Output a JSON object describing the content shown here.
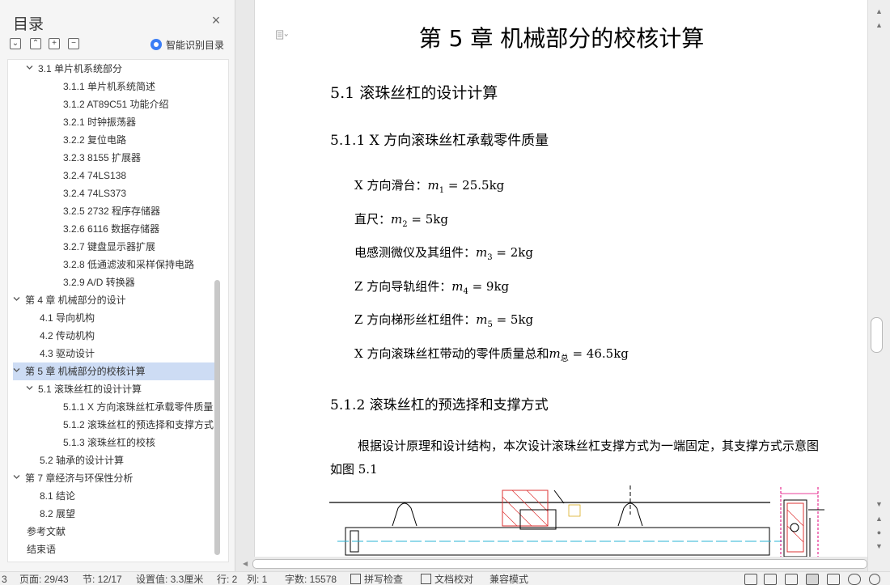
{
  "nav": {
    "title": "目录",
    "close": "×",
    "tools": [
      "⌄",
      "⌃",
      "+",
      "−"
    ],
    "smart_label": "智能识别目录",
    "items": [
      {
        "label": "3.1 单片机系统部分",
        "level": 1,
        "chev": true
      },
      {
        "label": "3.1.1 单片机系统简述",
        "level": 2
      },
      {
        "label": "3.1.2 AT89C51 功能介绍",
        "level": 2
      },
      {
        "label": "3.2.1 时钟振荡器",
        "level": 2
      },
      {
        "label": "3.2.2 复位电路",
        "level": 2
      },
      {
        "label": "3.2.3 8155 扩展器",
        "level": 2
      },
      {
        "label": "3.2.4 74LS138",
        "level": 2
      },
      {
        "label": "3.2.4 74LS373",
        "level": 2
      },
      {
        "label": "3.2.5 2732 程序存储器",
        "level": 2
      },
      {
        "label": "3.2.6 6116 数据存储器",
        "level": 2
      },
      {
        "label": "3.2.7  键盘显示器扩展",
        "level": 2
      },
      {
        "label": "3.2.8  低通滤波和采样保持电路",
        "level": 2
      },
      {
        "label": "3.2.9 A/D 转换器",
        "level": 2
      },
      {
        "label": "第 4 章  机械部分的设计",
        "level": 0,
        "chev": true
      },
      {
        "label": "4.1 导向机构",
        "level": 1
      },
      {
        "label": "4.2 传动机构",
        "level": 1
      },
      {
        "label": "4.3  驱动设计",
        "level": 1
      },
      {
        "label": "第 5 章  机械部分的校核计算",
        "level": 0,
        "chev": true,
        "selected": true
      },
      {
        "label": "5.1 滚珠丝杠的设计计算",
        "level": 1,
        "chev": true
      },
      {
        "label": "5.1.1 X 方向滚珠丝杠承载零件质量",
        "level": 2
      },
      {
        "label": "5.1.2  滚珠丝杠的预选择和支撑方式",
        "level": 2
      },
      {
        "label": "5.1.3  滚珠丝杠的校核",
        "level": 2
      },
      {
        "label": "5.2 轴承的设计计算",
        "level": 1
      },
      {
        "label": "第 7 章经济与环保性分析",
        "level": 0,
        "chev": true
      },
      {
        "label": "8.1 结论",
        "level": 1
      },
      {
        "label": "8.2  展望",
        "level": 1
      },
      {
        "label": "参考文献",
        "level": 0
      },
      {
        "label": "结束语",
        "level": 0
      }
    ]
  },
  "doc": {
    "chapter_title": "第 5 章  机械部分的校核计算",
    "section_title": "5.1 滚珠丝杠的设计计算",
    "sub1_title": "5.1.1 X 方向滚珠丝杠承载零件质量",
    "masses": [
      {
        "label": "X 方向滑台：",
        "var": "m",
        "sub": "1",
        "value": " = 25.5kg"
      },
      {
        "label": "直尺：",
        "var": "m",
        "sub": "2",
        "value": " = 5kg"
      },
      {
        "label": "电感测微仪及其组件：",
        "var": "m",
        "sub": "3",
        "value": " = 2kg"
      },
      {
        "label": "Z 方向导轨组件：",
        "var": "m",
        "sub": "4",
        "value": " = 9kg"
      },
      {
        "label": "Z 方向梯形丝杠组件：",
        "var": "m",
        "sub": "5",
        "value": " = 5kg"
      },
      {
        "label": "X 方向滚珠丝杠带动的零件质量总和",
        "var": "m",
        "sub": "总",
        "value": " = 46.5kg"
      }
    ],
    "sub2_title": "5.1.2  滚珠丝杠的预选择和支撑方式",
    "paragraph": "根据设计原理和设计结构，本次设计滚珠丝杠支撑方式为一端固定，其支撑方式示意图如图 5.1"
  },
  "status": {
    "page_prefix": "3",
    "page": "页面: 29/43",
    "section": "节: 12/17",
    "setting": "设置值: 3.3厘米",
    "row": "行: 2",
    "col": "列: 1",
    "words": "字数: 15578",
    "spell": "拼写检查",
    "proof": "文档校对",
    "compat": "兼容模式"
  },
  "colors": {
    "accent": "#3a7df5",
    "selected": "#cddcf4",
    "drawing": "#e0007a"
  }
}
